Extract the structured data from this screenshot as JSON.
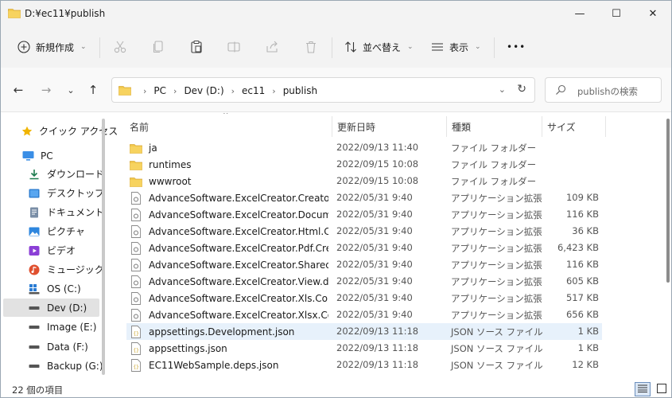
{
  "window": {
    "title": "D:¥ec11¥publish",
    "buttons": {
      "minimize": "—",
      "maximize": "☐",
      "close": "✕"
    }
  },
  "toolbar": {
    "new_label": "新規作成",
    "sort_label": "並べ替え",
    "view_label": "表示",
    "more_label": "•••"
  },
  "nav": {
    "back": "←",
    "forward": "→",
    "recent": "⌄",
    "up": "↑"
  },
  "address": {
    "crumbs": [
      "PC",
      "Dev (D:)",
      "ec11",
      "publish"
    ],
    "chevron": "›",
    "dropdown": "⌄",
    "refresh": "↻"
  },
  "search": {
    "placeholder": "publishの検索"
  },
  "sidebar": {
    "items": [
      {
        "label": "クイック アクセス",
        "icon": "star-icon"
      },
      {
        "label": "PC",
        "icon": "pc-icon"
      },
      {
        "label": "ダウンロード",
        "icon": "download-icon"
      },
      {
        "label": "デスクトップ",
        "icon": "desktop-icon"
      },
      {
        "label": "ドキュメント",
        "icon": "document-icon"
      },
      {
        "label": "ピクチャ",
        "icon": "pictures-icon"
      },
      {
        "label": "ビデオ",
        "icon": "video-icon"
      },
      {
        "label": "ミュージック",
        "icon": "music-icon"
      },
      {
        "label": "OS (C:)",
        "icon": "windows-drive-icon"
      },
      {
        "label": "Dev (D:)",
        "icon": "drive-icon"
      },
      {
        "label": "Image (E:)",
        "icon": "drive-icon"
      },
      {
        "label": "Data (F:)",
        "icon": "drive-icon"
      },
      {
        "label": "Backup (G:)",
        "icon": "drive-icon"
      }
    ]
  },
  "columns": {
    "name": "名前",
    "date": "更新日時",
    "type": "種類",
    "size": "サイズ"
  },
  "files": [
    {
      "name": "ja",
      "date": "2022/09/13 11:40",
      "type": "ファイル フォルダー",
      "size": "",
      "kind": "folder"
    },
    {
      "name": "runtimes",
      "date": "2022/09/15 10:08",
      "type": "ファイル フォルダー",
      "size": "",
      "kind": "folder"
    },
    {
      "name": "wwwroot",
      "date": "2022/09/15 10:08",
      "type": "ファイル フォルダー",
      "size": "",
      "kind": "folder"
    },
    {
      "name": "AdvanceSoftware.ExcelCreator.Creator.dll",
      "date": "2022/05/31 9:40",
      "type": "アプリケーション拡張",
      "size": "109 KB",
      "kind": "dll"
    },
    {
      "name": "AdvanceSoftware.ExcelCreator.Document....",
      "date": "2022/05/31 9:40",
      "type": "アプリケーション拡張",
      "size": "116 KB",
      "kind": "dll"
    },
    {
      "name": "AdvanceSoftware.ExcelCreator.Html.Crea...",
      "date": "2022/05/31 9:40",
      "type": "アプリケーション拡張",
      "size": "36 KB",
      "kind": "dll"
    },
    {
      "name": "AdvanceSoftware.ExcelCreator.Pdf.Creato...",
      "date": "2022/05/31 9:40",
      "type": "アプリケーション拡張",
      "size": "6,423 KB",
      "kind": "dll"
    },
    {
      "name": "AdvanceSoftware.ExcelCreator.Shared.dll",
      "date": "2022/05/31 9:40",
      "type": "アプリケーション拡張",
      "size": "116 KB",
      "kind": "dll"
    },
    {
      "name": "AdvanceSoftware.ExcelCreator.View.dll",
      "date": "2022/05/31 9:40",
      "type": "アプリケーション拡張",
      "size": "605 KB",
      "kind": "dll"
    },
    {
      "name": "AdvanceSoftware.ExcelCreator.Xls.Core.dll",
      "date": "2022/05/31 9:40",
      "type": "アプリケーション拡張",
      "size": "517 KB",
      "kind": "dll"
    },
    {
      "name": "AdvanceSoftware.ExcelCreator.Xlsx.Core.dll",
      "date": "2022/05/31 9:40",
      "type": "アプリケーション拡張",
      "size": "656 KB",
      "kind": "dll"
    },
    {
      "name": "appsettings.Development.json",
      "date": "2022/09/13 11:18",
      "type": "JSON ソース ファイル",
      "size": "1 KB",
      "kind": "json",
      "selected": true
    },
    {
      "name": "appsettings.json",
      "date": "2022/09/13 11:18",
      "type": "JSON ソース ファイル",
      "size": "1 KB",
      "kind": "json"
    },
    {
      "name": "EC11WebSample.deps.json",
      "date": "2022/09/13 11:18",
      "type": "JSON ソース ファイル",
      "size": "12 KB",
      "kind": "json"
    }
  ],
  "status": {
    "count": "22 個の項目"
  },
  "colors": {
    "accent": "#0067c0",
    "folder": "#f2c94c",
    "selected_row": "#e7f1fb"
  }
}
